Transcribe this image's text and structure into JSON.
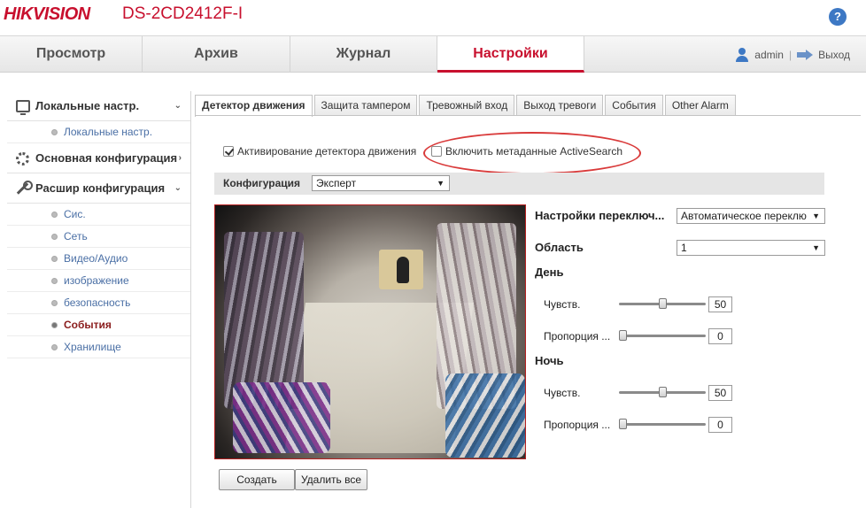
{
  "header": {
    "logo_text": "HIKVISION",
    "model": "DS-2CD2412F-I",
    "help_glyph": "?"
  },
  "nav": {
    "tabs": [
      {
        "label": "Просмотр"
      },
      {
        "label": "Архив"
      },
      {
        "label": "Журнал"
      },
      {
        "label": "Настройки",
        "active": true
      }
    ],
    "user": "admin",
    "logout_label": "Выход"
  },
  "sidebar": {
    "local_group": "Локальные настр.",
    "local_item": "Локальные настр.",
    "basic_group": "Основная конфигурация",
    "advanced_group": "Расшир конфигурация",
    "items": [
      "Сис.",
      "Сеть",
      "Видео/Аудио",
      "изображение",
      "безопасность",
      "События",
      "Хранилище"
    ],
    "active_item": "События"
  },
  "content_tabs": [
    "Детектор движения",
    "Защита тампером",
    "Тревожный вход",
    "Выход тревоги",
    "События",
    "Other Alarm"
  ],
  "options": {
    "enable_motion_label": "Активирование детектора движения",
    "enable_motion_checked": true,
    "enable_metadata_label": "Включить метаданные ActiveSearch",
    "enable_metadata_checked": false
  },
  "config": {
    "label": "Конфигурация",
    "mode": "Эксперт"
  },
  "settings": {
    "switch_label": "Настройки переключ...",
    "switch_value": "Автоматическое переклю",
    "area_label": "Область",
    "area_value": "1",
    "day_label": "День",
    "night_label": "Ночь",
    "day_sensitivity_label": "Чувств.",
    "day_sensitivity_value": "50",
    "day_ratio_label": "Пропорция ...",
    "day_ratio_value": "0",
    "night_sensitivity_label": "Чувств.",
    "night_sensitivity_value": "50",
    "night_ratio_label": "Пропорция ...",
    "night_ratio_value": "0",
    "day_sensitivity_level": 0.5,
    "day_ratio_level": 0,
    "night_sensitivity_level": 0.5,
    "night_ratio_level": 0
  },
  "buttons": {
    "create": "Создать",
    "delete_all": "Удалить все"
  },
  "colors": {
    "brand_red": "#c8102e",
    "link_blue": "#4a6fa5",
    "highlight_ellipse": "#d93a3a"
  }
}
